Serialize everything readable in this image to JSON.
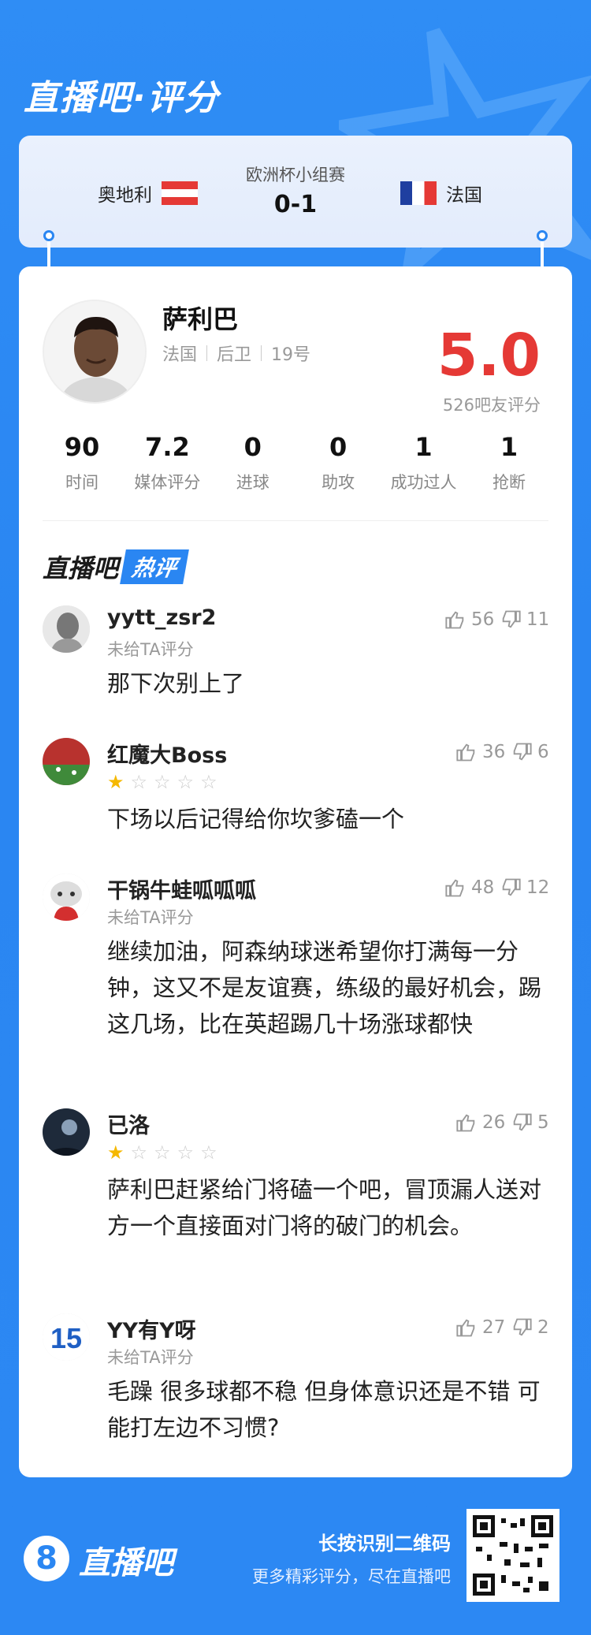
{
  "brand_title": "直播吧·评分",
  "match": {
    "competition": "欧洲杯小组赛",
    "score": "0-1",
    "home_team": "奥地利",
    "away_team": "法国"
  },
  "player": {
    "name": "萨利巴",
    "team": "法国",
    "position": "后卫",
    "number": "19号",
    "rating": "5.0",
    "rating_count": "526吧友评分"
  },
  "stats": [
    {
      "value": "90",
      "label": "时间"
    },
    {
      "value": "7.2",
      "label": "媒体评分"
    },
    {
      "value": "0",
      "label": "进球"
    },
    {
      "value": "0",
      "label": "助攻"
    },
    {
      "value": "1",
      "label": "成功过人"
    },
    {
      "value": "1",
      "label": "抢断"
    }
  ],
  "hot_section": {
    "prefix": "直播吧",
    "highlight": "热评"
  },
  "comments": [
    {
      "user": "yytt_zsr2",
      "sub": "未给TA评分",
      "stars": null,
      "likes": "56",
      "dislikes": "11",
      "text": "那下次别上了"
    },
    {
      "user": "红魔大Boss",
      "sub": "",
      "stars": 1,
      "likes": "36",
      "dislikes": "6",
      "text": "下场以后记得给你坎爹磕一个"
    },
    {
      "user": "干锅牛蛙呱呱呱",
      "sub": "未给TA评分",
      "stars": null,
      "likes": "48",
      "dislikes": "12",
      "text": "继续加油，阿森纳球迷希望你打满每一分钟，这又不是友谊赛，练级的最好机会，踢这几场，比在英超踢几十场涨球都快"
    },
    {
      "user": "已洛",
      "sub": "",
      "stars": 1,
      "likes": "26",
      "dislikes": "5",
      "text": "萨利巴赶紧给门将磕一个吧，冒顶漏人送对方一个直接面对门将的破门的机会。"
    },
    {
      "user": "YY有Y呀",
      "sub": "未给TA评分",
      "stars": null,
      "likes": "27",
      "dislikes": "2",
      "text": "毛躁 很多球都不稳 但身体意识还是不错 可能打左边不习惯?"
    }
  ],
  "footer": {
    "logo_mark": "8",
    "logo_text": "直播吧",
    "qr_label": "长按识别二维码",
    "qr_sub": "更多精彩评分，尽在直播吧"
  },
  "colors": {
    "primary": "#2a86f2",
    "rating": "#e53935",
    "star": "#f5b800"
  }
}
